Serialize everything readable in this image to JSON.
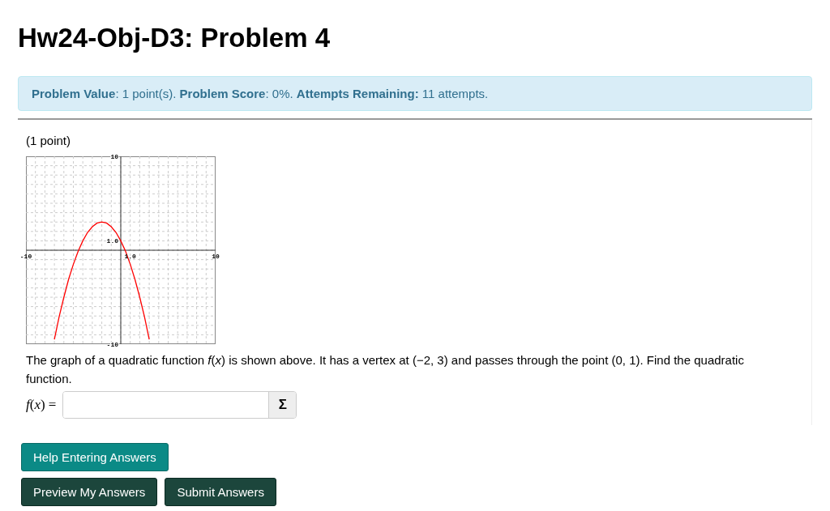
{
  "title": "Hw24-Obj-D3: Problem 4",
  "info": "**Problem Value**: 1 point(s). **Problem Score**: 0%. **Attempts Remaining:** 11 attempts.",
  "points": "(1 point)",
  "graph": {
    "chart_data": {
      "type": "line",
      "x": [
        -7,
        -6.5,
        -6,
        -5.5,
        -5,
        -4.5,
        -4,
        -3.5,
        -3,
        -2.5,
        -2,
        -1.5,
        -1,
        -0.5,
        0,
        0.5,
        1,
        1.5,
        2,
        2.5,
        3
      ],
      "series": [
        {
          "color": "#ff0000",
          "values": [
            -9.5,
            -7.1,
            -5,
            -3.1,
            -1.5,
            -0.1,
            1,
            1.9,
            2.5,
            2.9,
            3,
            2.9,
            2.5,
            1.9,
            1,
            -0.1,
            -1.5,
            -3.1,
            -5,
            -7.1,
            -9.5
          ]
        }
      ],
      "xlim": [
        -10,
        10
      ],
      "ylim": [
        -10,
        10
      ],
      "xticks": [
        {
          "value": -10,
          "label": "-10"
        },
        {
          "value": 1,
          "label": "1.0"
        },
        {
          "value": 10,
          "label": "10"
        }
      ],
      "yticks": [
        {
          "value": 10,
          "label": "10"
        },
        {
          "value": 1,
          "label": "1.0"
        },
        {
          "value": -10,
          "label": "-10"
        }
      ]
    }
  },
  "question": "The graph of a quadratic function *f*(*x*) is shown above. It has a vertex at (−2, 3) and passes through the point (0, 1). Find the quadratic function.",
  "answer": {
    "label": "*f*(*x*) =",
    "equation_button": "Σ"
  },
  "buttons": [
    {
      "label": "Help Entering Answers",
      "kind": "help"
    },
    {
      "label": "Preview My Answers",
      "kind": "action"
    },
    {
      "label": "Submit Answers",
      "kind": "action"
    }
  ]
}
